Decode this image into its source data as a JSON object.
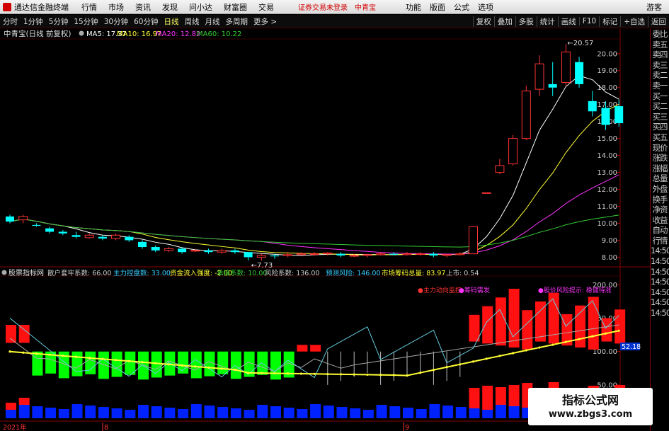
{
  "menubar": {
    "app_title": "通达信金融终端",
    "items": [
      "行情",
      "市场",
      "资讯",
      "发现",
      "问小达",
      "财富圈",
      "交易"
    ],
    "warning": "证券交易未登录",
    "stock_link": "中青宝",
    "right_items": [
      "功能",
      "版面",
      "公式",
      "选项"
    ],
    "guest": "游客"
  },
  "toolbar": {
    "periods": [
      "分时",
      "1分钟",
      "5分钟",
      "15分钟",
      "30分钟",
      "60分钟",
      "日线",
      "周线",
      "月线",
      "多周期",
      "更多 >"
    ],
    "active_period": "日线",
    "right": [
      "复权",
      "叠加",
      "多股",
      "统计",
      "画线",
      "F10",
      "标记",
      "+自选",
      "返回"
    ]
  },
  "main_chart": {
    "title": "中青宝(日线 前复权)",
    "ma": [
      {
        "label": "MA5: 17.37",
        "color": "#ffffff"
      },
      {
        "label": "MA10: 16.97",
        "color": "#ffff33"
      },
      {
        "label": "MA20: 12.82",
        "color": "#ff33ff"
      },
      {
        "label": "MA60: 10.22",
        "color": "#33cc33"
      }
    ],
    "y_ticks": [
      "20.00",
      "19.00",
      "18.00",
      "17.00",
      "16.00",
      "15.00",
      "14.00",
      "13.00",
      "12.00",
      "11.00",
      "10.00",
      "9.00",
      "8.00"
    ],
    "high_label": "20.57",
    "low_label": "7.73"
  },
  "indicator": {
    "title": "股票指标网",
    "items": [
      {
        "label": "散户套牢系数: 66.00",
        "color": "#cccccc"
      },
      {
        "label": "主力控盘数: 33.00",
        "color": "#33ccff"
      },
      {
        "label": "资金流入强度: -2.00",
        "color": "#ffff33"
      },
      {
        "label": "承接系数: 10.00",
        "color": "#33cc33"
      },
      {
        "label": "风险系数: 136.00",
        "color": "#cccccc"
      },
      {
        "label": "预测风险: 146.00",
        "color": "#33ccff"
      },
      {
        "label": "市场筹码总量: 83.97",
        "color": "#ffff33"
      },
      {
        "label": "上市: 0.54",
        "color": "#cccccc"
      }
    ],
    "y_ticks": [
      "200.00",
      "150.00",
      "100.00",
      "50.00"
    ],
    "last_value": "52.18",
    "annotations": {
      "a1": "●主力动向监控",
      "a2": "●筹码需发",
      "a3": "●股价风险提示: 稳健待涨"
    }
  },
  "right_panel": [
    "委比",
    "卖五",
    "卖四",
    "卖三",
    "卖二",
    "卖一",
    "买一",
    "买二",
    "买三",
    "买四",
    "买五",
    "现价",
    "涨跌",
    "涨幅",
    "总量",
    "外盘",
    "换手",
    "净资",
    "收益",
    "自动",
    "行情",
    "14:50",
    "14:50",
    "14:50",
    "14:50",
    "14:50",
    "14:50",
    "14:50"
  ],
  "time_axis": {
    "labels": [
      "2021年",
      "8",
      "9"
    ]
  },
  "watermark": {
    "line1": "指标公式网",
    "line2": "www.zbgs3.com"
  },
  "chart_data": {
    "type": "candlestick",
    "candles": [
      [
        10.4,
        10.1,
        10.5,
        10.0
      ],
      [
        10.2,
        10.4,
        10.5,
        10.0
      ],
      [
        9.9,
        9.85,
        10.0,
        9.8
      ],
      [
        9.7,
        9.5,
        9.8,
        9.4
      ],
      [
        9.5,
        9.4,
        9.6,
        9.3
      ],
      [
        9.3,
        9.2,
        9.5,
        9.1
      ],
      [
        9.15,
        9.3,
        9.4,
        9.1
      ],
      [
        9.2,
        9.1,
        9.3,
        9.0
      ],
      [
        9.1,
        9.3,
        9.4,
        9.0
      ],
      [
        9.2,
        9.0,
        9.3,
        8.9
      ],
      [
        8.9,
        8.6,
        9.0,
        8.5
      ],
      [
        8.6,
        8.4,
        8.7,
        8.3
      ],
      [
        8.4,
        8.5,
        8.6,
        8.3
      ],
      [
        8.5,
        8.3,
        8.6,
        8.2
      ],
      [
        8.4,
        8.4,
        8.5,
        8.3
      ],
      [
        8.4,
        8.3,
        8.5,
        8.2
      ],
      [
        8.3,
        8.4,
        8.5,
        8.2
      ],
      [
        8.4,
        8.3,
        8.5,
        8.2
      ],
      [
        8.3,
        8.0,
        8.3,
        7.8
      ],
      [
        8.0,
        8.1,
        8.2,
        7.8
      ],
      [
        8.1,
        8.05,
        8.2,
        7.9
      ],
      [
        8.1,
        8.15,
        8.3,
        8.0
      ],
      [
        8.15,
        8.2,
        8.3,
        8.1
      ],
      [
        8.2,
        8.2,
        8.3,
        8.1
      ],
      [
        8.2,
        8.25,
        8.3,
        8.1
      ],
      [
        8.2,
        8.1,
        8.3,
        8.0
      ],
      [
        8.1,
        8.1,
        8.2,
        8.0
      ],
      [
        8.1,
        8.15,
        8.2,
        8.0
      ],
      [
        8.15,
        8.2,
        8.3,
        8.1
      ],
      [
        8.2,
        8.15,
        8.3,
        8.1
      ],
      [
        8.15,
        8.2,
        8.3,
        8.1
      ],
      [
        8.2,
        8.2,
        8.3,
        8.1
      ],
      [
        8.2,
        8.1,
        8.3,
        8.0
      ],
      [
        8.1,
        8.15,
        8.2,
        8.0
      ],
      [
        8.15,
        8.2,
        8.3,
        8.1
      ],
      [
        8.2,
        9.8,
        9.8,
        8.2
      ],
      [
        11.8,
        11.8,
        11.8,
        11.8
      ],
      [
        13.0,
        13.4,
        13.8,
        12.9
      ],
      [
        13.5,
        15.0,
        15.2,
        13.4
      ],
      [
        15.0,
        17.8,
        18.1,
        14.9
      ],
      [
        17.9,
        19.4,
        19.9,
        17.5
      ],
      [
        18.2,
        18.0,
        19.5,
        17.5
      ],
      [
        18.3,
        20.1,
        20.57,
        18.1
      ],
      [
        19.5,
        18.2,
        19.8,
        18.0
      ],
      [
        17.2,
        16.6,
        17.8,
        16.3
      ],
      [
        16.8,
        15.8,
        17.2,
        15.5
      ],
      [
        16.9,
        15.9,
        17.3,
        15.7
      ]
    ],
    "y_range": [
      7.6,
      20.7
    ]
  }
}
